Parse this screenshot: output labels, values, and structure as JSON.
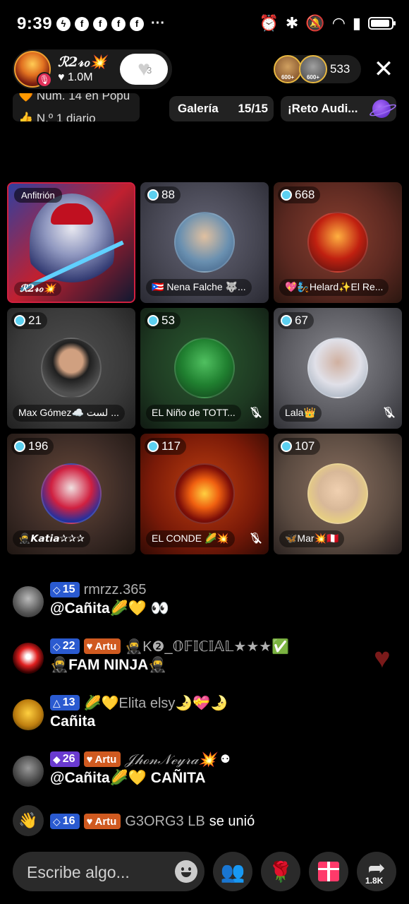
{
  "status_bar": {
    "time": "9:39",
    "apps": [
      "messenger-icon",
      "facebook-icon",
      "facebook-icon",
      "facebook-icon",
      "facebook-icon"
    ],
    "more": "···"
  },
  "host": {
    "name": "ℛ2𝓇ℴ💥",
    "likes": "♥ 1.0M",
    "follow_count": "3"
  },
  "viewers": {
    "badge1": "600+",
    "badge2": "600+",
    "count": "533"
  },
  "rank": {
    "line1": "🧡 Núm. 14 en Popu",
    "line2": "👍 N.º 1 diario"
  },
  "gallery": {
    "label": "Galería",
    "count": "15/15"
  },
  "challenge": {
    "label": "¡Reto Audi..."
  },
  "seats": [
    {
      "tag": "Anfitrión",
      "name": "ℛ2𝓇ℴ💥"
    },
    {
      "level": "88",
      "name": "🇵🇷 Nena Falche 🐺..."
    },
    {
      "level": "668",
      "name": "💖🧞Helard✨El Re..."
    },
    {
      "level": "21",
      "name": "Max Gómez☁️ لست ..."
    },
    {
      "level": "53",
      "name": "EL Niño de  TOTT..."
    },
    {
      "level": "67",
      "name": "Lala👑"
    },
    {
      "level": "196",
      "name": "🥷𝙆𝙖𝙩𝙞𝙖✰✰✰"
    },
    {
      "level": "117",
      "name": "EL CONDE 🌽💥"
    },
    {
      "level": "107",
      "name": "🦋Mar💥🇵🇪"
    }
  ],
  "chat": [
    {
      "level": "15",
      "user": "rmrzz.365",
      "message": "@Cañita🌽💛 👀"
    },
    {
      "level": "22",
      "badge": "Artu",
      "user": "🥷K❷_𝕆𝔽𝕀ℂ𝕀𝔸𝕃★★★✅",
      "message": "🥷FAM NINJA🥷"
    },
    {
      "level": "13",
      "user": "🌽💛Elita elsy🌛💝🌛",
      "message": "Cañita"
    },
    {
      "level": "26",
      "badge": "Artu",
      "user": "𝒥𝒽ℴ𝓃𝒩ℯ𝓎𝓇𝒶💥",
      "message": "@Cañita🌽💛 CAÑITA"
    },
    {
      "level": "16",
      "badge": "Artu",
      "user": "G3ORG3 LB",
      "join_text": "se unió"
    }
  ],
  "composer": {
    "placeholder": "Escribe algo...",
    "share_count": "1.8K"
  },
  "colors": {
    "background": "#000000",
    "pill": "#1c1c1c",
    "level_blue": "#2a5ad0",
    "level_purple": "#6a3ad0",
    "artu_badge": "#d05a20",
    "accent_pink": "#ff3aa0"
  }
}
